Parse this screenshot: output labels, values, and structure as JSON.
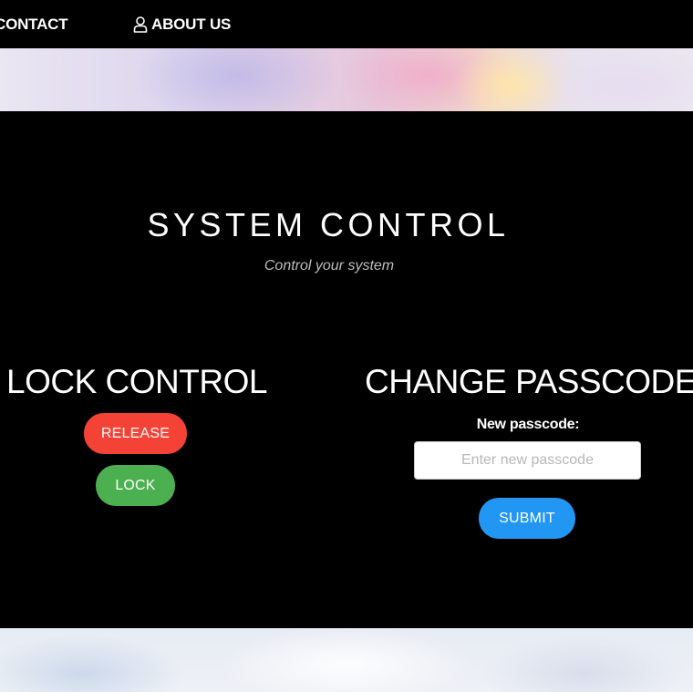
{
  "nav": {
    "items": [
      {
        "label": "CONTACT",
        "icon": "envelope-icon"
      },
      {
        "label": "ABOUT US",
        "icon": "user-icon"
      }
    ]
  },
  "header": {
    "title": "SYSTEM CONTROL",
    "subtitle": "Control your system"
  },
  "lock_control": {
    "title": "LOCK CONTROL",
    "release_label": "RELEASE",
    "lock_label": "LOCK"
  },
  "change_passcode": {
    "title": "CHANGE PASSCODE",
    "field_label": "New passcode:",
    "placeholder": "Enter new passcode",
    "value": "",
    "submit_label": "SUBMIT"
  },
  "colors": {
    "release": "#f44336",
    "lock": "#4caf50",
    "submit": "#2196f3",
    "background": "#000000"
  }
}
